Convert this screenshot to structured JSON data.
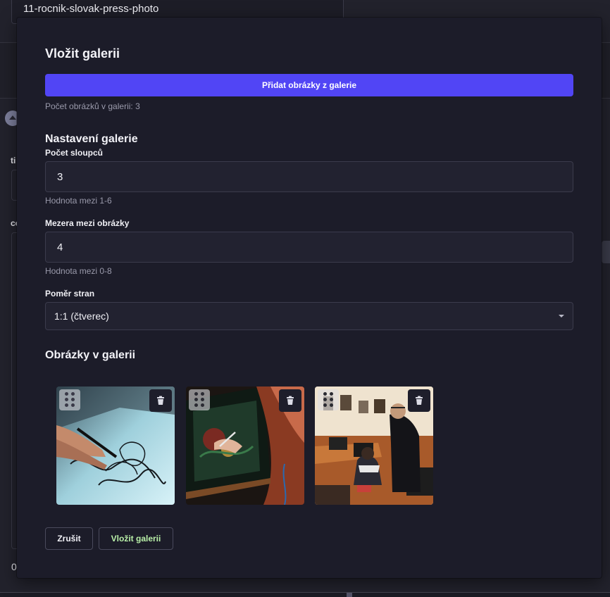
{
  "background": {
    "slug": "11-rocnik-slovak-press-photo",
    "label_a": "ti",
    "label_b": "co",
    "bottom_value": "0"
  },
  "modal": {
    "title": "Vložit galerii",
    "add_button": "Přidat obrázky z galerie",
    "image_count": "Počet obrázků v galerii: 3",
    "settings_title": "Nastavení galerie",
    "columns": {
      "label": "Počet sloupců",
      "value": "3",
      "hint": "Hodnota mezi 1-6"
    },
    "gap": {
      "label": "Mezera mezi obrázky",
      "value": "4",
      "hint": "Hodnota mezi 0-8"
    },
    "ratio": {
      "label": "Poměr stran",
      "selected": "1:1 (čtverec)"
    },
    "images_title": "Obrázky v galerii",
    "images": [
      {
        "name": "drawing-tablet-sketch"
      },
      {
        "name": "girl-drawing-on-tablet"
      },
      {
        "name": "classroom-computers"
      }
    ],
    "cancel_button": "Zrušit",
    "insert_button": "Vložit galerii"
  },
  "colors": {
    "accent": "#5145f5",
    "modal_bg": "#1c1c29",
    "insert_text": "#b9f0a8"
  }
}
